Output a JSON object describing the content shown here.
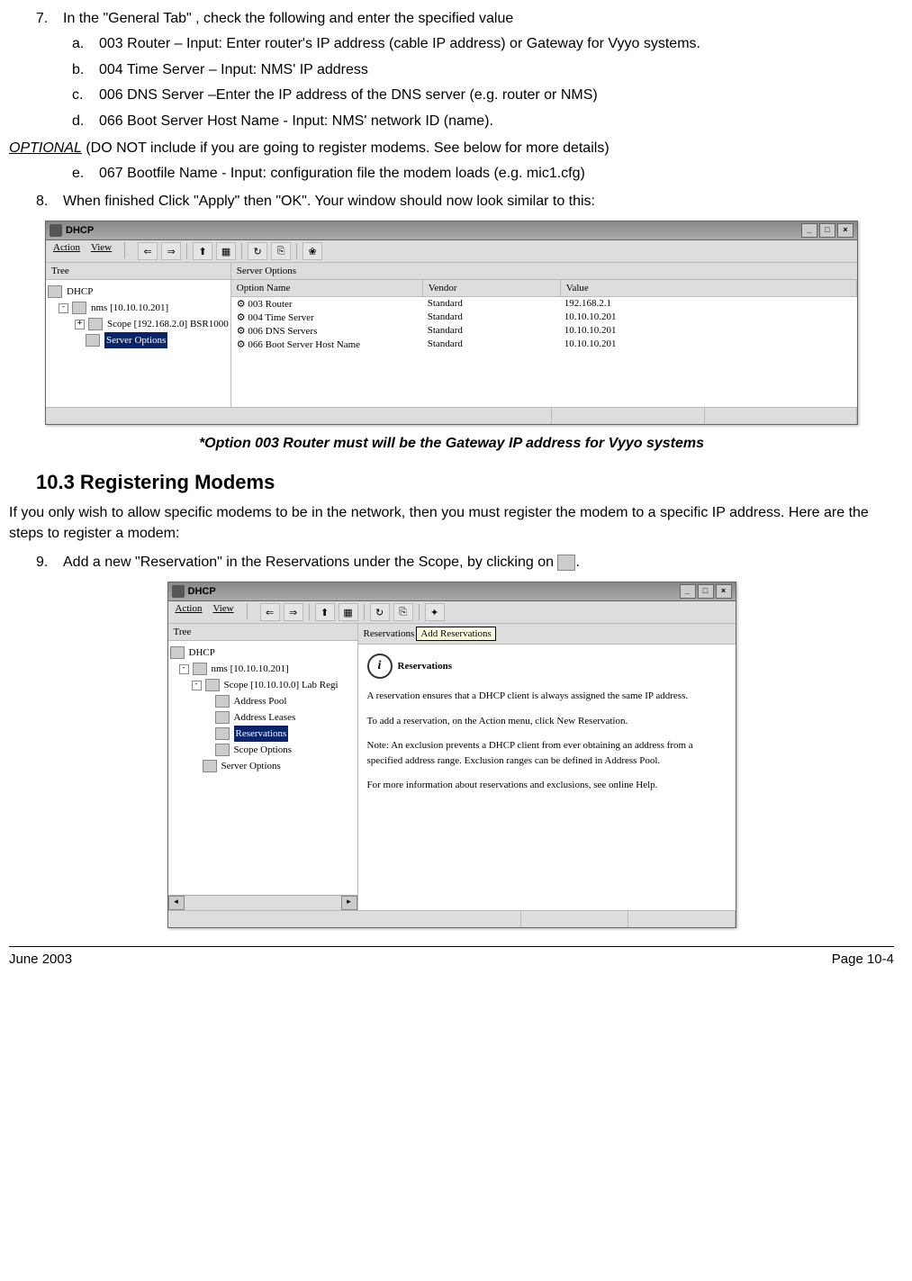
{
  "steps": {
    "s7": {
      "num": "7.",
      "text": "In the \"General Tab\" , check the following and enter the specified value",
      "a": {
        "let": "a.",
        "text": "003 Router – Input: Enter router's IP address (cable IP address) or Gateway for Vyyo systems."
      },
      "b": {
        "let": "b.",
        "text": "004 Time Server – Input: NMS' IP address"
      },
      "c": {
        "let": "c.",
        "text": "006 DNS Server –Enter the IP address of the DNS server (e.g. router or NMS)"
      },
      "d": {
        "let": "d.",
        "text": "066 Boot Server Host Name - Input: NMS' network ID (name)."
      }
    },
    "optional": {
      "label": "OPTIONAL",
      "rest": " (DO NOT include if you are going to register modems.  See below for more details)"
    },
    "e": {
      "let": "e.",
      "text": "067 Bootfile Name - Input: configuration file the modem loads (e.g. mic1.cfg)"
    },
    "s8": {
      "num": "8.",
      "text": "When finished Click \"Apply\" then \"OK\".  Your window should now look similar to this:"
    },
    "s9": {
      "num": "9.",
      "text": "Add a new \"Reservation\" in the Reservations under the Scope, by clicking on "
    }
  },
  "win1": {
    "title": "DHCP",
    "menus": {
      "action": "Action",
      "view": "View"
    },
    "treeTab": "Tree",
    "serverOptions": "Server Options",
    "tree": {
      "root": "DHCP",
      "nms": "nms [10.10.10.201]",
      "scope": "Scope [192.168.2.0] BSR1000",
      "so": "Server Options"
    },
    "cols": {
      "c1": "Option Name",
      "c2": "Vendor",
      "c3": "Value"
    },
    "rows": [
      {
        "o": "003 Router",
        "v": "Standard",
        "val": "192.168.2.1"
      },
      {
        "o": "004 Time Server",
        "v": "Standard",
        "val": "10.10.10.201"
      },
      {
        "o": "006 DNS Servers",
        "v": "Standard",
        "val": "10.10.10.201"
      },
      {
        "o": "066 Boot Server Host Name",
        "v": "Standard",
        "val": "10.10.10.201"
      }
    ]
  },
  "note": "*Option 003 Router must will be the Gateway IP address for Vyyo systems",
  "h2": "10.3  Registering Modems",
  "para": "If you only wish to allow specific modems to be in the network, then you must register the modem to a specific IP address.  Here are the steps to register a modem:",
  "win2": {
    "title": "DHCP",
    "menus": {
      "action": "Action",
      "view": "View"
    },
    "treeTab": "Tree",
    "paneHead": "Reservations",
    "tooltip": "Add Reservations",
    "tree": {
      "root": "DHCP",
      "nms": "nms [10.10.10.201]",
      "scope": "Scope [10.10.10.0] Lab Regi",
      "ap": "Address Pool",
      "al": "Address Leases",
      "res": "Reservations",
      "sop": "Scope Options",
      "srv": "Server Options"
    },
    "contentHead": "Reservations",
    "p1": "A reservation ensures that a DHCP client is always assigned the same IP address.",
    "p2": "To add a reservation, on the Action menu, click New Reservation.",
    "p3": "Note: An exclusion prevents a DHCP client from ever obtaining an address from a specified address range.  Exclusion ranges can be defined in Address Pool.",
    "p4": "For more information about reservations and exclusions, see online Help."
  },
  "footer": {
    "left": "June 2003",
    "right": "Page 10-4"
  }
}
